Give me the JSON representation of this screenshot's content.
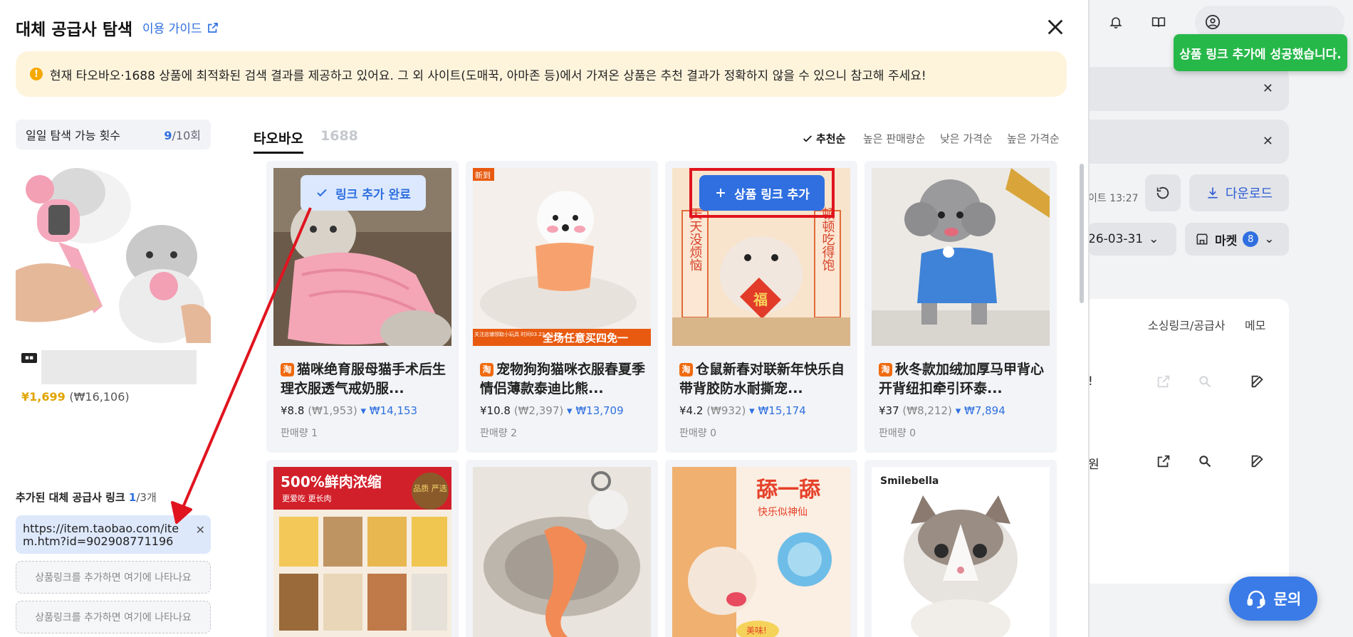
{
  "modal": {
    "title": "대체 공급사 탐색",
    "guide_link": "이용 가이드",
    "notice": "현재 타오바오·1688 상품에 최적화된 검색 결과를 제공하고 있어요. 그 외 사이트(도매꾹, 아마존 등)에서 가져온 상품은 추천 결과가 정확하지 않을 수 있으니 참고해 주세요!"
  },
  "left": {
    "quota_label": "일일 탐색 가능 횟수",
    "quota_used": "9",
    "quota_total": "/10회",
    "source_price": "¥1,699",
    "source_price_krw": "(₩16,106)",
    "added_title": "추가된 대체 공급사 링크",
    "added_count": "1",
    "added_max": "/3개",
    "added_link": "https://item.taobao.com/item.htm?id=902908771196",
    "slot_placeholder_1": "상품링크를 추가하면 여기에 나타나요",
    "slot_placeholder_2": "상품링크를 추가하면 여기에 나타나요"
  },
  "tabs": [
    {
      "label": "타오바오",
      "active": true
    },
    {
      "label": "1688",
      "active": false
    }
  ],
  "sort": {
    "options": [
      "추천순",
      "높은 판매량순",
      "낮은 가격순",
      "높은 가격순"
    ],
    "selected": "추천순"
  },
  "buttons": {
    "link_added": "링크 추가 완료",
    "add_link": "상품 링크 추가"
  },
  "products": [
    {
      "title": "猫咪绝育服母猫手术后生理衣服透气戒奶服...",
      "price": "¥8.8",
      "krw": "(₩1,953)",
      "estimate": "₩14,153",
      "sales": "판매량 1"
    },
    {
      "title": "宠物狗狗猫咪衣服春夏季情侣薄款泰迪比熊...",
      "price": "¥10.8",
      "krw": "(₩2,397)",
      "estimate": "₩13,709",
      "sales": "판매량 2"
    },
    {
      "title": "仓鼠新春对联新年快乐自带背胶防水耐撕宠...",
      "price": "¥4.2",
      "krw": "(₩932)",
      "estimate": "₩15,174",
      "sales": "판매량 0"
    },
    {
      "title": "秋冬款加绒加厚马甲背心开背纽扣牵引环泰...",
      "price": "¥37",
      "krw": "(₩8,212)",
      "estimate": "₩7,894",
      "sales": "판매량 0"
    }
  ],
  "product_image_text": {
    "p2_tag": "新到",
    "p2_banner": "全场任意买四免一",
    "p2_banner_small": "关注店铺领取小玩具 时间03.23-03.31",
    "p3_left": "天天没烦恼",
    "p3_right": "顿顿吃得饱",
    "p3_center": "福",
    "p5_headline": "500%鲜肉浓缩",
    "p5_sub": "更爱吃 更长肉",
    "p5_badge": "品质 严选",
    "p7_headline": "舔一舔",
    "p7_sub": "快乐似神仙",
    "p7_bubble": "美味!",
    "p8_brand": "Smilebella"
  },
  "background_app": {
    "updated_time": "이트 13:27",
    "download": "다운로드",
    "date_range": "26-03-31",
    "market_label": "마켓",
    "market_count": "8",
    "col_sourcing": "소싱링크/공급사",
    "col_memo": "메모",
    "row1_text": "!",
    "row2_text": "원",
    "toast": "상품 링크 추가에 성공했습니다.",
    "help": "문의"
  },
  "colors": {
    "accent": "#2f6fe0",
    "toast": "#27b84a",
    "notice_bg": "#fef4dc",
    "highlight": "#e0141f",
    "taobao": "#f06a0f"
  }
}
